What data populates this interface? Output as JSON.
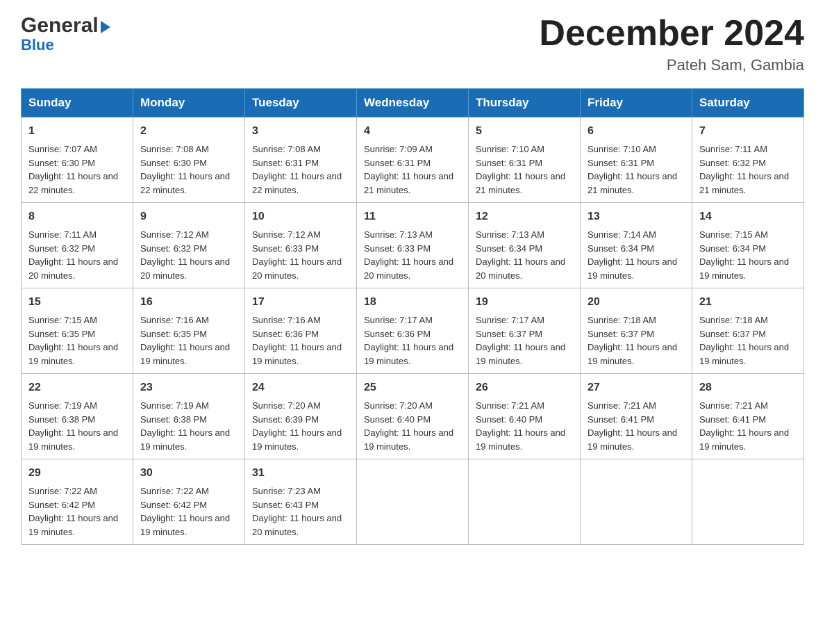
{
  "header": {
    "logo_general": "General",
    "logo_blue": "Blue",
    "month_title": "December 2024",
    "location": "Pateh Sam, Gambia"
  },
  "days_of_week": [
    "Sunday",
    "Monday",
    "Tuesday",
    "Wednesday",
    "Thursday",
    "Friday",
    "Saturday"
  ],
  "weeks": [
    [
      {
        "day": "1",
        "sunrise": "7:07 AM",
        "sunset": "6:30 PM",
        "daylight": "11 hours and 22 minutes."
      },
      {
        "day": "2",
        "sunrise": "7:08 AM",
        "sunset": "6:30 PM",
        "daylight": "11 hours and 22 minutes."
      },
      {
        "day": "3",
        "sunrise": "7:08 AM",
        "sunset": "6:31 PM",
        "daylight": "11 hours and 22 minutes."
      },
      {
        "day": "4",
        "sunrise": "7:09 AM",
        "sunset": "6:31 PM",
        "daylight": "11 hours and 21 minutes."
      },
      {
        "day": "5",
        "sunrise": "7:10 AM",
        "sunset": "6:31 PM",
        "daylight": "11 hours and 21 minutes."
      },
      {
        "day": "6",
        "sunrise": "7:10 AM",
        "sunset": "6:31 PM",
        "daylight": "11 hours and 21 minutes."
      },
      {
        "day": "7",
        "sunrise": "7:11 AM",
        "sunset": "6:32 PM",
        "daylight": "11 hours and 21 minutes."
      }
    ],
    [
      {
        "day": "8",
        "sunrise": "7:11 AM",
        "sunset": "6:32 PM",
        "daylight": "11 hours and 20 minutes."
      },
      {
        "day": "9",
        "sunrise": "7:12 AM",
        "sunset": "6:32 PM",
        "daylight": "11 hours and 20 minutes."
      },
      {
        "day": "10",
        "sunrise": "7:12 AM",
        "sunset": "6:33 PM",
        "daylight": "11 hours and 20 minutes."
      },
      {
        "day": "11",
        "sunrise": "7:13 AM",
        "sunset": "6:33 PM",
        "daylight": "11 hours and 20 minutes."
      },
      {
        "day": "12",
        "sunrise": "7:13 AM",
        "sunset": "6:34 PM",
        "daylight": "11 hours and 20 minutes."
      },
      {
        "day": "13",
        "sunrise": "7:14 AM",
        "sunset": "6:34 PM",
        "daylight": "11 hours and 19 minutes."
      },
      {
        "day": "14",
        "sunrise": "7:15 AM",
        "sunset": "6:34 PM",
        "daylight": "11 hours and 19 minutes."
      }
    ],
    [
      {
        "day": "15",
        "sunrise": "7:15 AM",
        "sunset": "6:35 PM",
        "daylight": "11 hours and 19 minutes."
      },
      {
        "day": "16",
        "sunrise": "7:16 AM",
        "sunset": "6:35 PM",
        "daylight": "11 hours and 19 minutes."
      },
      {
        "day": "17",
        "sunrise": "7:16 AM",
        "sunset": "6:36 PM",
        "daylight": "11 hours and 19 minutes."
      },
      {
        "day": "18",
        "sunrise": "7:17 AM",
        "sunset": "6:36 PM",
        "daylight": "11 hours and 19 minutes."
      },
      {
        "day": "19",
        "sunrise": "7:17 AM",
        "sunset": "6:37 PM",
        "daylight": "11 hours and 19 minutes."
      },
      {
        "day": "20",
        "sunrise": "7:18 AM",
        "sunset": "6:37 PM",
        "daylight": "11 hours and 19 minutes."
      },
      {
        "day": "21",
        "sunrise": "7:18 AM",
        "sunset": "6:37 PM",
        "daylight": "11 hours and 19 minutes."
      }
    ],
    [
      {
        "day": "22",
        "sunrise": "7:19 AM",
        "sunset": "6:38 PM",
        "daylight": "11 hours and 19 minutes."
      },
      {
        "day": "23",
        "sunrise": "7:19 AM",
        "sunset": "6:38 PM",
        "daylight": "11 hours and 19 minutes."
      },
      {
        "day": "24",
        "sunrise": "7:20 AM",
        "sunset": "6:39 PM",
        "daylight": "11 hours and 19 minutes."
      },
      {
        "day": "25",
        "sunrise": "7:20 AM",
        "sunset": "6:40 PM",
        "daylight": "11 hours and 19 minutes."
      },
      {
        "day": "26",
        "sunrise": "7:21 AM",
        "sunset": "6:40 PM",
        "daylight": "11 hours and 19 minutes."
      },
      {
        "day": "27",
        "sunrise": "7:21 AM",
        "sunset": "6:41 PM",
        "daylight": "11 hours and 19 minutes."
      },
      {
        "day": "28",
        "sunrise": "7:21 AM",
        "sunset": "6:41 PM",
        "daylight": "11 hours and 19 minutes."
      }
    ],
    [
      {
        "day": "29",
        "sunrise": "7:22 AM",
        "sunset": "6:42 PM",
        "daylight": "11 hours and 19 minutes."
      },
      {
        "day": "30",
        "sunrise": "7:22 AM",
        "sunset": "6:42 PM",
        "daylight": "11 hours and 19 minutes."
      },
      {
        "day": "31",
        "sunrise": "7:23 AM",
        "sunset": "6:43 PM",
        "daylight": "11 hours and 20 minutes."
      },
      null,
      null,
      null,
      null
    ]
  ]
}
